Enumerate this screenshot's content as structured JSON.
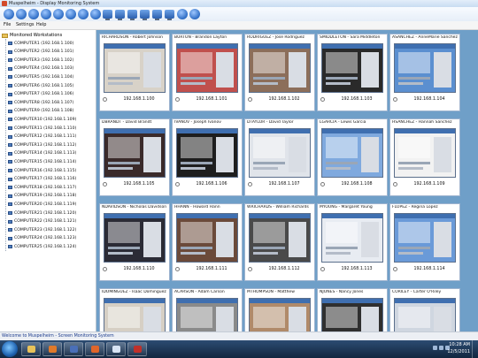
{
  "window": {
    "title": "Muspelheim - Display Monitoring System"
  },
  "toolbar": {
    "buttons": [
      {
        "icon": "tools-icon"
      },
      {
        "icon": "refresh-icon"
      },
      {
        "icon": "power-icon"
      },
      {
        "icon": "info-icon"
      },
      {
        "icon": "info-icon"
      },
      {
        "icon": "info-icon"
      },
      {
        "icon": "info-icon"
      },
      {
        "icon": "info-icon"
      },
      {
        "icon": "monitor-icon"
      },
      {
        "icon": "monitor-icon"
      },
      {
        "icon": "monitor-icon"
      },
      {
        "icon": "monitor-icon"
      },
      {
        "icon": "monitor-icon"
      },
      {
        "icon": "monitor-icon"
      },
      {
        "icon": "globe-icon"
      },
      {
        "icon": "info-icon"
      }
    ]
  },
  "menu": {
    "file": "File",
    "settings": "Settings",
    "help": "Help"
  },
  "tree": {
    "root": "Monitored Workstations",
    "items": [
      "COMPUTER1 (192.168.1.100)",
      "COMPUTER2 (192.168.1.101)",
      "COMPUTER3 (192.168.1.102)",
      "COMPUTER4 (192.168.1.103)",
      "COMPUTER5 (192.168.1.104)",
      "COMPUTER6 (192.168.1.105)",
      "COMPUTER7 (192.168.1.106)",
      "COMPUTER8 (192.168.1.107)",
      "COMPUTER9 (192.168.1.108)",
      "COMPUTER10 (192.168.1.109)",
      "COMPUTER11 (192.168.1.110)",
      "COMPUTER12 (192.168.1.111)",
      "COMPUTER13 (192.168.1.112)",
      "COMPUTER14 (192.168.1.113)",
      "COMPUTER15 (192.168.1.114)",
      "COMPUTER16 (192.168.1.115)",
      "COMPUTER17 (192.168.1.116)",
      "COMPUTER18 (192.168.1.117)",
      "COMPUTER19 (192.168.1.118)",
      "COMPUTER20 (192.168.1.119)",
      "COMPUTER21 (192.168.1.120)",
      "COMPUTER22 (192.168.1.121)",
      "COMPUTER23 (192.168.1.122)",
      "COMPUTER24 (192.168.1.123)",
      "COMPUTER25 (192.168.1.124)"
    ]
  },
  "tiles": [
    {
      "name": "RICHARDSON - Robert Johnson",
      "ip": "192.168.1.100",
      "accent": "#d8d2c8"
    },
    {
      "name": "BURTON - Brandon Layton",
      "ip": "192.168.1.101",
      "accent": "#c0504d"
    },
    {
      "name": "RODRIGUEZ - Jose Rodriguez",
      "ip": "192.168.1.102",
      "accent": "#8c6e5a"
    },
    {
      "name": "SMIDDLETON - Sara Middleton",
      "ip": "192.168.1.103",
      "accent": "#2a2a2a"
    },
    {
      "name": "ASANCHEZ - AnneMarie Sanchez",
      "ip": "192.168.1.104",
      "accent": "#5b8fd0"
    },
    {
      "name": "DBRANDT - David Brandt",
      "ip": "192.168.1.105",
      "accent": "#3a2a2a"
    },
    {
      "name": "IVANOV - Joseph Ivanov",
      "ip": "192.168.1.106",
      "accent": "#1e1e1e"
    },
    {
      "name": "DTAYLOR - David Taylor",
      "ip": "192.168.1.107",
      "accent": "#e0e4ea"
    },
    {
      "name": "LGARCIA - Lewis Garcia",
      "ip": "192.168.1.108",
      "accent": "#7fa9de"
    },
    {
      "name": "HSANCHEZ - Hannah Sanchez",
      "ip": "192.168.1.109",
      "accent": "#f2f2f2"
    },
    {
      "name": "NDAVIDSON - Nicholas Davidson",
      "ip": "192.168.1.110",
      "accent": "#2b2b35"
    },
    {
      "name": "HHANN - Howard Hann",
      "ip": "192.168.1.111",
      "accent": "#6b4a3a"
    },
    {
      "name": "WRICHARDS - William Richards",
      "ip": "192.168.1.112",
      "accent": "#4a4a4a"
    },
    {
      "name": "MYOUNG - Margaret Young",
      "ip": "192.168.1.113",
      "accent": "#e8ecf2"
    },
    {
      "name": "FLOPEZ - Regina Lopez",
      "ip": "192.168.1.114",
      "accent": "#6a9ad8"
    },
    {
      "name": "IDOMINGUEZ - Isaac Dominguez",
      "ip": "",
      "accent": "#d6cfc4"
    },
    {
      "name": "ACARSON - Adam Carson",
      "ip": "",
      "accent": "#8a8a8a"
    },
    {
      "name": "MTHOMPSON - Matthew",
      "ip": "",
      "accent": "#b08a6a"
    },
    {
      "name": "NJONES - Nancy Jones",
      "ip": "",
      "accent": "#2f2f2f"
    },
    {
      "name": "CORILEY - Carter O'Riley",
      "ip": "",
      "accent": "#cfd6e0"
    }
  ],
  "status": {
    "text": "Welcome to Muspelheim - Screen Monitoring System"
  },
  "taskbar": {
    "items": [
      {
        "icon": "explorer-icon",
        "color": "#e8c25a"
      },
      {
        "icon": "media-player-icon",
        "color": "#e07a2a"
      },
      {
        "icon": "music-player-icon",
        "color": "#4a6fb8"
      },
      {
        "icon": "firefox-icon",
        "color": "#e0662a"
      },
      {
        "icon": "window-icon",
        "color": "#d8e4f4"
      },
      {
        "icon": "app-icon",
        "color": "#c0302a"
      }
    ],
    "clock": {
      "time": "10:28 AM",
      "date": "12/5/2011"
    }
  }
}
